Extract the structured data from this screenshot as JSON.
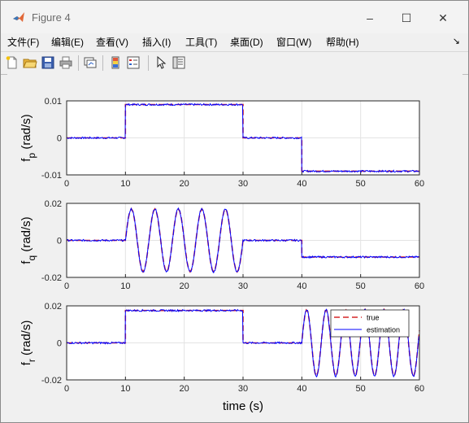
{
  "window": {
    "title": "Figure 4",
    "minimize": "–",
    "maximize": "☐",
    "close": "✕"
  },
  "menu": [
    {
      "label": "文件(F)"
    },
    {
      "label": "编辑(E)"
    },
    {
      "label": "查看(V)"
    },
    {
      "label": "插入(I)"
    },
    {
      "label": "工具(T)"
    },
    {
      "label": "桌面(D)"
    },
    {
      "label": "窗口(W)"
    },
    {
      "label": "帮助(H)"
    }
  ],
  "menu_overflow_icon": "dock-arrow-icon",
  "toolbar": [
    {
      "icon": "new-figure-icon"
    },
    {
      "icon": "open-file-icon"
    },
    {
      "icon": "save-icon"
    },
    {
      "icon": "print-icon"
    },
    {
      "icon": "link-plot-icon"
    },
    {
      "icon": "insert-colorbar-icon"
    },
    {
      "icon": "insert-legend-icon"
    },
    {
      "icon": "pointer-icon"
    },
    {
      "icon": "property-inspector-icon"
    }
  ],
  "chart_data": [
    {
      "type": "line",
      "ylabel_main": "f",
      "ylabel_sub": "p",
      "ylabel_unit": "(rad/s)",
      "xlim": [
        0,
        60
      ],
      "ylim": [
        -0.01,
        0.01
      ],
      "xticks": [
        "0",
        "10",
        "20",
        "30",
        "40",
        "50",
        "60"
      ],
      "yticks": [
        "-0.01",
        "0",
        "0.01"
      ],
      "grid": true,
      "series": [
        {
          "name": "true",
          "color": "#d62728",
          "style": "dashed",
          "segments": [
            [
              0,
              10,
              0
            ],
            [
              10,
              30,
              0.009
            ],
            [
              30,
              40,
              0
            ],
            [
              40,
              60,
              -0.009
            ]
          ]
        },
        {
          "name": "estimation",
          "color": "#0000ff",
          "style": "solid",
          "segments": [
            [
              0,
              10,
              0
            ],
            [
              10,
              30,
              0.009
            ],
            [
              30,
              40,
              0
            ],
            [
              40,
              60,
              -0.009
            ]
          ]
        }
      ]
    },
    {
      "type": "line",
      "ylabel_main": "f",
      "ylabel_sub": "q",
      "ylabel_unit": "(rad/s)",
      "xlim": [
        0,
        60
      ],
      "ylim": [
        -0.02,
        0.02
      ],
      "xticks": [
        "0",
        "10",
        "20",
        "30",
        "40",
        "50",
        "60"
      ],
      "yticks": [
        "-0.02",
        "0",
        "0.02"
      ],
      "grid": true,
      "series": [
        {
          "name": "true",
          "color": "#d62728",
          "style": "dashed",
          "segments": [
            [
              0,
              10,
              0
            ],
            [
              10,
              30,
              "sin 0.017 period 4"
            ],
            [
              30,
              40,
              0
            ],
            [
              40,
              60,
              -0.009
            ]
          ]
        },
        {
          "name": "estimation",
          "color": "#0000ff",
          "style": "solid",
          "segments": [
            [
              0,
              10,
              0
            ],
            [
              10,
              30,
              "sin 0.017 period 4"
            ],
            [
              30,
              40,
              0
            ],
            [
              40,
              60,
              -0.009
            ]
          ]
        }
      ]
    },
    {
      "type": "line",
      "ylabel_main": "f",
      "ylabel_sub": "r",
      "ylabel_unit": "(rad/s)",
      "xlabel": "time (s)",
      "xlim": [
        0,
        60
      ],
      "ylim": [
        -0.02,
        0.02
      ],
      "xticks": [
        "0",
        "10",
        "20",
        "30",
        "40",
        "50",
        "60"
      ],
      "yticks": [
        "-0.02",
        "0",
        "0.02"
      ],
      "grid": true,
      "legend_position": "top-right",
      "series": [
        {
          "name": "true",
          "color": "#d62728",
          "style": "dashed",
          "segments": [
            [
              0,
              10,
              0
            ],
            [
              10,
              30,
              0.0175
            ],
            [
              30,
              40,
              0
            ],
            [
              40,
              60,
              "sin 0.018 period 3.3"
            ]
          ]
        },
        {
          "name": "estimation",
          "color": "#0000ff",
          "style": "solid",
          "segments": [
            [
              0,
              10,
              0
            ],
            [
              10,
              30,
              0.0175
            ],
            [
              30,
              40,
              0
            ],
            [
              40,
              60,
              "sin 0.018 period 3.3"
            ]
          ]
        }
      ]
    }
  ]
}
